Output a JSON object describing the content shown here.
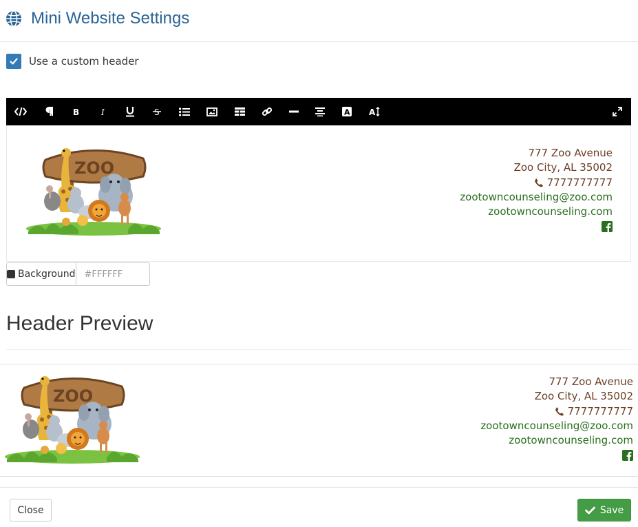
{
  "header": {
    "title": "Mini Website Settings",
    "icon": "globe-icon"
  },
  "custom_header": {
    "checked": true,
    "label": "Use a custom header"
  },
  "toolbar": {
    "buttons": [
      "code-view",
      "paragraph",
      "bold",
      "italic",
      "underline",
      "strikethrough",
      "unordered-list",
      "image",
      "table",
      "link",
      "horizontal-rule",
      "align",
      "font-color",
      "font-size",
      "fullscreen"
    ]
  },
  "editor": {
    "logo_text": "ZOO",
    "address_line1": "777 Zoo Avenue",
    "address_line2": "Zoo City, AL 35002",
    "phone": "7777777777",
    "email": "zootowncounseling@zoo.com",
    "website": "zootowncounseling.com",
    "social": "facebook-icon"
  },
  "background": {
    "label": "Background",
    "placeholder": "#FFFFFF"
  },
  "preview": {
    "title": "Header Preview",
    "logo_text": "ZOO",
    "address_line1": "777 Zoo Avenue",
    "address_line2": "Zoo City, AL 35002",
    "phone": "7777777777",
    "email": "zootowncounseling@zoo.com",
    "website": "zootowncounseling.com"
  },
  "footer": {
    "close_label": "Close",
    "save_label": "Save"
  },
  "colors": {
    "title": "#2a6496",
    "address": "#6b3e26",
    "links": "#2a6e1f",
    "save": "#449d44",
    "checkbox": "#337ab7"
  }
}
